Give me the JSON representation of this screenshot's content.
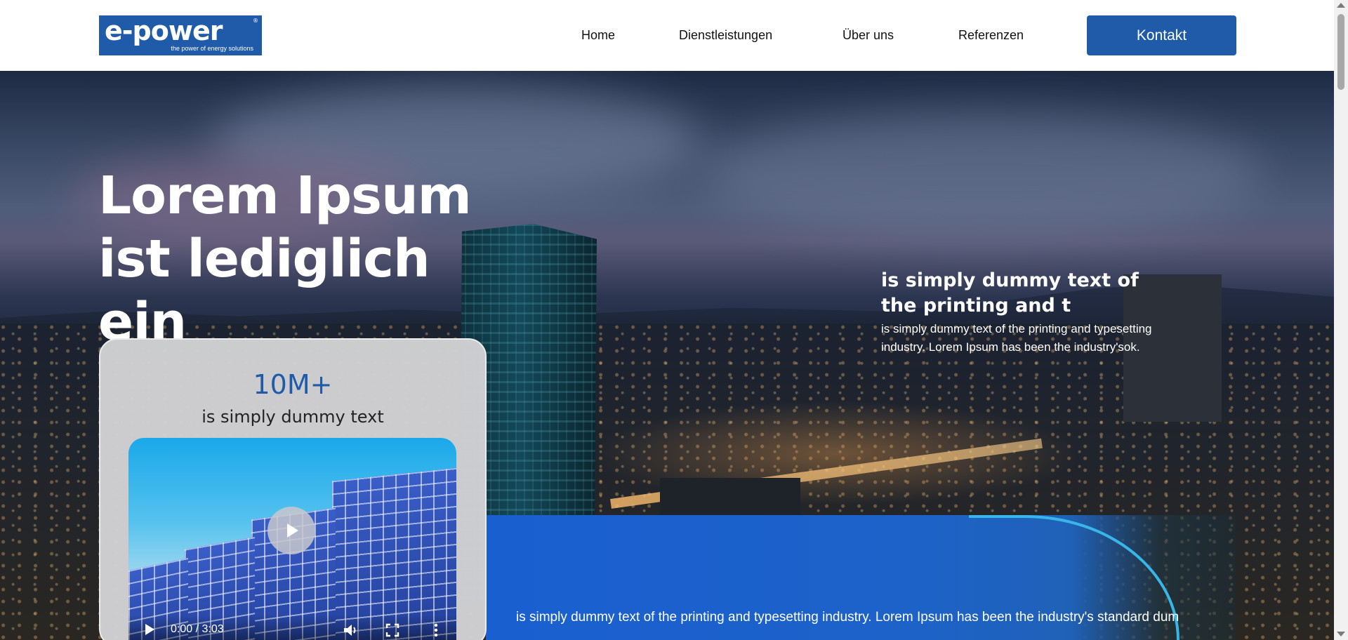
{
  "header": {
    "logo": {
      "main": "e-power",
      "registered": "®",
      "tagline": "the power of energy solutions"
    },
    "nav": [
      {
        "label": "Home"
      },
      {
        "label": "Dienstleistungen"
      },
      {
        "label": "Über uns"
      },
      {
        "label": "Referenzen"
      }
    ],
    "contact_label": "Kontakt"
  },
  "hero": {
    "title": "Lorem Ipsum ist lediglich ein",
    "right_heading": "is simply dummy text of the printing and t",
    "right_text": "is simply dummy text of the printing and typesetting industry. Lorem Ipsum has been the industry'sok."
  },
  "stat_card": {
    "number": "10M+",
    "subtitle": "is simply dummy text",
    "video": {
      "time": "0:00 / 3:03",
      "icons": [
        "play-icon",
        "volume-icon",
        "fullscreen-icon",
        "more-options-icon"
      ]
    }
  },
  "blue_bar": {
    "text": "is simply dummy text of the printing and typesetting industry. Lorem Ipsum has been the industry's standard dum"
  },
  "colors": {
    "brand_blue": "#1f5ba8",
    "bar_blue": "#1a5fd0",
    "arc_accent": "#38b6e8"
  }
}
